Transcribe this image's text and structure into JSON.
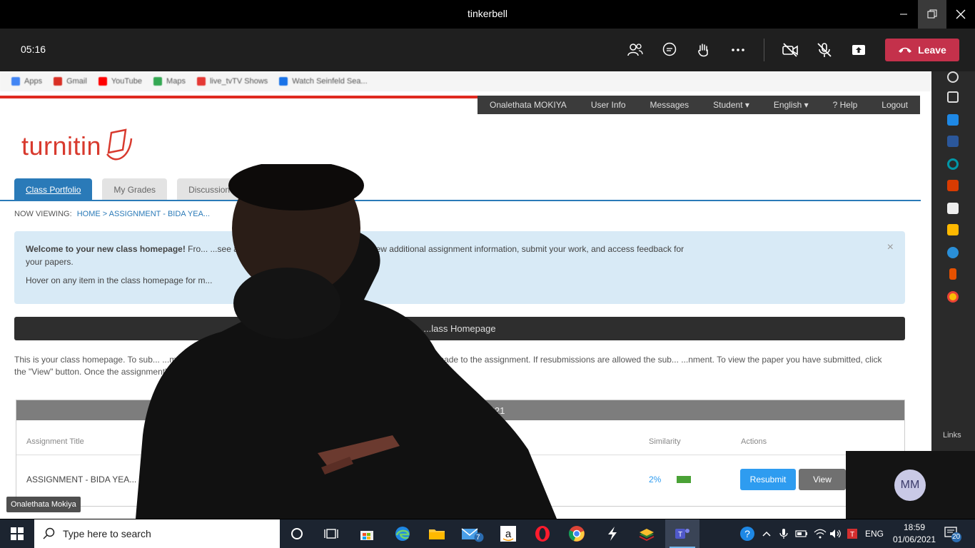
{
  "window": {
    "title": "tinkerbell"
  },
  "meeting": {
    "timer": "05:16",
    "leave_label": "Leave",
    "participant_name": "Onalethata Mokiya",
    "self_initials": "MM"
  },
  "browser": {
    "bookmarks": [
      {
        "label": "Apps",
        "icon": "apps-grid-icon",
        "color": "#4285f4"
      },
      {
        "label": "Gmail",
        "icon": "gmail-icon",
        "color": "#d93025"
      },
      {
        "label": "YouTube",
        "icon": "youtube-icon",
        "color": "#ff0000"
      },
      {
        "label": "Maps",
        "icon": "maps-icon",
        "color": "#34a853"
      },
      {
        "label": "live_tvTV Shows",
        "icon": "tv-icon",
        "color": "#e53935"
      },
      {
        "label": "Watch Seinfeld Sea...",
        "icon": "site-icon",
        "color": "#1a73e8"
      }
    ]
  },
  "turnitin": {
    "logo_text": "turnitin",
    "topnav": [
      "Onalethata MOKIYA",
      "User Info",
      "Messages",
      "Student ▾",
      "English ▾",
      "? Help",
      "Logout"
    ],
    "tabs": [
      "Class Portfolio",
      "My Grades",
      "Discussion"
    ],
    "now_viewing_label": "NOW VIEWING:",
    "breadcrumb": "HOME > ASSIGNMENT - BIDA YEA...",
    "welcome": {
      "title": "Welcome to your new class homepage!",
      "line1_rest": " Fro...                                                          ...see all your assignments for your class, view additional assignment information, submit your work, and access feedback for",
      "line2": "your papers.",
      "line3": "Hover on any item in the class homepage for m..."
    },
    "section_title": "...lass Homepage",
    "paragraph": "This is your class homepage. To sub...                                                                                                          ...ment name. If the Submit button is grayed out, no submissions can be made to the assignment. If resubmissions are allowed the sub...                                                                                                     ...nment. To view the paper you have submitted, click the \"View\" button. Once the assignment's post date has passed, you will also be...",
    "table": {
      "header": "...A YEAR 1 FBI 2021",
      "columns": {
        "title": "Assignment Title",
        "similarity": "Similarity",
        "actions": "Actions"
      },
      "row": {
        "title": "ASSIGNMENT - BIDA YEA...",
        "similarity": "2%",
        "resubmit": "Resubmit",
        "view": "View"
      }
    },
    "sidebar_links_label": "Links"
  },
  "taskbar": {
    "search_placeholder": "Type here to search",
    "mail_badge": "7",
    "lang": "ENG",
    "time": "18:59",
    "date": "01/06/2021",
    "notif_count": "20"
  },
  "colors": {
    "leave_red": "#c4314b",
    "turnitin_red": "#d83a2e",
    "tab_blue": "#2a7ab8",
    "resubmit_blue": "#2e9cf0"
  }
}
